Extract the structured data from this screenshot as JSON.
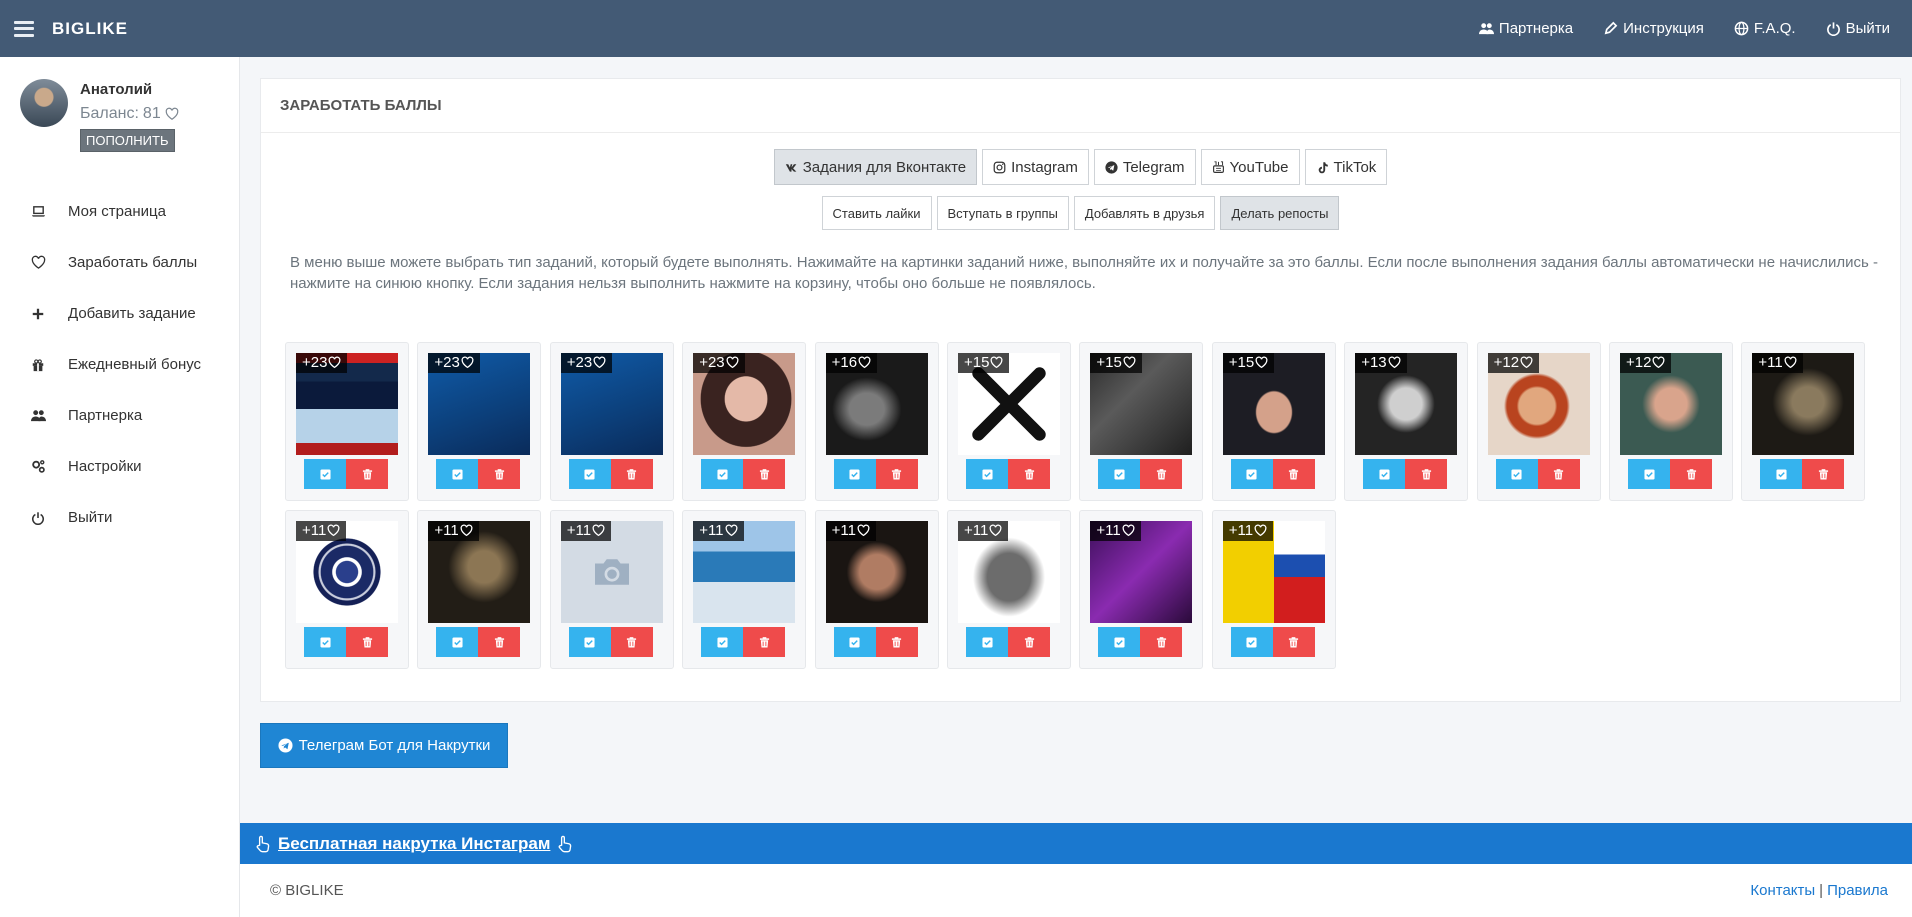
{
  "navbar": {
    "brand": "BIGLIKE",
    "links": [
      {
        "label": "Партнерка",
        "icon": "users-icon"
      },
      {
        "label": "Инструкция",
        "icon": "pencil-icon"
      },
      {
        "label": "F.A.Q.",
        "icon": "globe-icon"
      },
      {
        "label": "Выйти",
        "icon": "power-icon"
      }
    ]
  },
  "sidebar": {
    "user_name": "Анатолий",
    "balance_label": "Баланс:",
    "balance_value": "81",
    "topup_label": "ПОПОЛНИТЬ",
    "items": [
      {
        "label": "Моя страница",
        "icon": "laptop-icon"
      },
      {
        "label": "Заработать баллы",
        "icon": "heart-icon"
      },
      {
        "label": "Добавить задание",
        "icon": "plus-icon"
      },
      {
        "label": "Ежедневный бонус",
        "icon": "gift-icon"
      },
      {
        "label": "Партнерка",
        "icon": "users-icon"
      },
      {
        "label": "Настройки",
        "icon": "gears-icon"
      },
      {
        "label": "Выйти",
        "icon": "power-icon"
      }
    ]
  },
  "card": {
    "title": "ЗАРАБОТАТЬ БАЛЛЫ",
    "tabs": [
      {
        "label": "Задания для Вконтакте",
        "icon": "vk-icon",
        "active": true
      },
      {
        "label": "Instagram",
        "icon": "instagram-icon",
        "active": false
      },
      {
        "label": "Telegram",
        "icon": "telegram-icon",
        "active": false
      },
      {
        "label": "YouTube",
        "icon": "youtube-icon",
        "active": false
      },
      {
        "label": "TikTok",
        "icon": "tiktok-icon",
        "active": false
      }
    ],
    "subtabs": [
      {
        "label": "Ставить лайки",
        "active": false
      },
      {
        "label": "Вступать в группы",
        "active": false
      },
      {
        "label": "Добавлять в друзья",
        "active": false
      },
      {
        "label": "Делать репосты",
        "active": true
      }
    ],
    "description": "В меню выше можете выбрать тип заданий, который будете выполнять. Нажимайте на картинки заданий ниже, выполняйте их и получайте за это баллы. Если после выполнения задания баллы автоматически не начислились - нажмите на синюю кнопку. Если задания нельзя выполнить нажмите на корзину, чтобы оно больше не появлялось.",
    "tasks": [
      {
        "points": "+23",
        "thumb": "fonbet"
      },
      {
        "points": "+23",
        "thumb": "1x"
      },
      {
        "points": "+23",
        "thumb": "1x"
      },
      {
        "points": "+23",
        "thumb": "girl"
      },
      {
        "points": "+16",
        "thumb": "bw1"
      },
      {
        "points": "+15",
        "thumb": "x"
      },
      {
        "points": "+15",
        "thumb": "night"
      },
      {
        "points": "+15",
        "thumb": "man1"
      },
      {
        "points": "+13",
        "thumb": "bw2"
      },
      {
        "points": "+12",
        "thumb": "woman"
      },
      {
        "points": "+12",
        "thumb": "man2"
      },
      {
        "points": "+11",
        "thumb": "dark1"
      },
      {
        "points": "+11",
        "thumb": "zodiac"
      },
      {
        "points": "+11",
        "thumb": "dark2"
      },
      {
        "points": "+11",
        "thumb": "empty"
      },
      {
        "points": "+11",
        "thumb": "sea"
      },
      {
        "points": "+11",
        "thumb": "woman2"
      },
      {
        "points": "+11",
        "thumb": "gargoyle"
      },
      {
        "points": "+11",
        "thumb": "purple"
      },
      {
        "points": "+11",
        "thumb": "flag"
      }
    ]
  },
  "telegram_button": "Телеграм Бот для Накрутки",
  "banner": {
    "label": "Бесплатная накрутка Инстаграм"
  },
  "footer": {
    "copyright": "© BIGLIKE",
    "contacts": "Контакты",
    "separator": "|",
    "rules": "Правила"
  },
  "colors": {
    "navbar": "#435a75",
    "accent_blue": "#1a78cf",
    "ok_button": "#35b3ee",
    "delete_button": "#ef4b4b"
  }
}
